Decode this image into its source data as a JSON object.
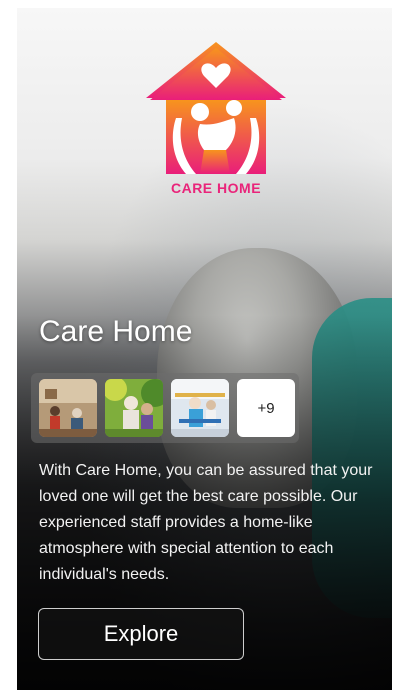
{
  "brand": {
    "logo_text": "CARE HOME",
    "logo_icon": "house-family-heart-icon",
    "gradient_top": "#f7941d",
    "gradient_bottom": "#e91e7a"
  },
  "hero": {
    "title": "Care Home"
  },
  "gallery": {
    "thumbnails": [
      {
        "name": "activity-room-photo"
      },
      {
        "name": "garden-visit-photo"
      },
      {
        "name": "therapy-session-photo"
      }
    ],
    "more_label": "+9"
  },
  "description": "With Care Home, you can be assured that your loved one will get the best care possible. Our experienced staff provides a home-like atmosphere with special attention to each individual's needs.",
  "cta": {
    "explore_label": "Explore"
  }
}
